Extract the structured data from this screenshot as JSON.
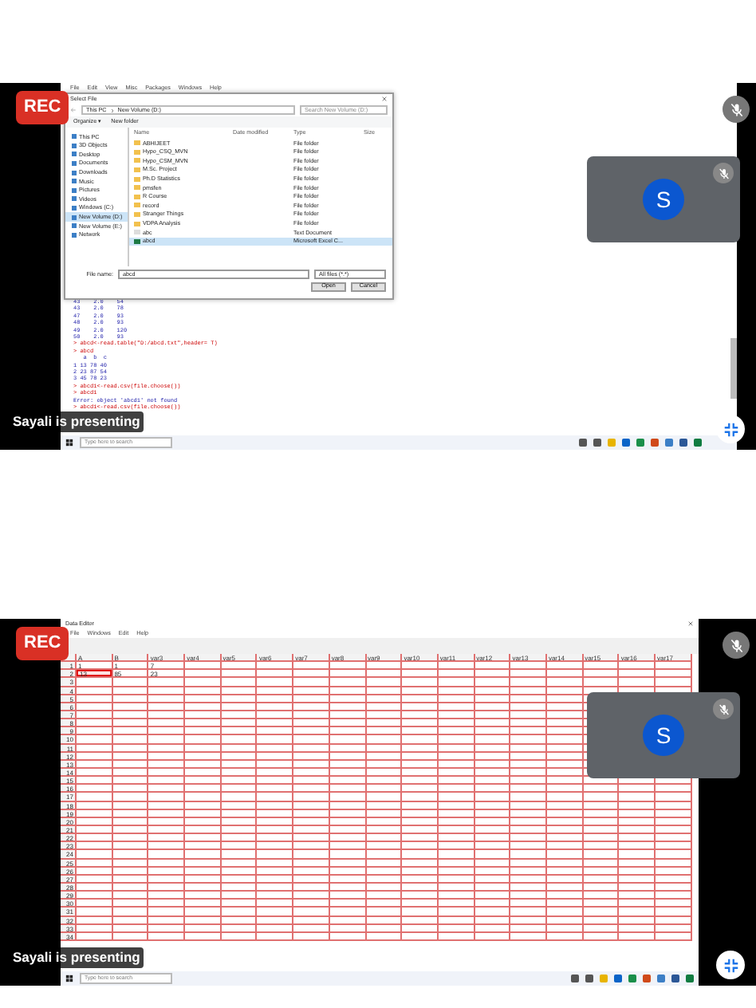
{
  "tiles": [
    {
      "rec": "REC",
      "presenter": "Sayali is presenting",
      "self_muted": true,
      "participant": {
        "initial": "S",
        "muted": true
      },
      "screen": {
        "kind": "r_console",
        "menu": [
          "File",
          "Edit",
          "View",
          "Misc",
          "Packages",
          "Windows",
          "Help"
        ],
        "dialog": {
          "title": "Select File",
          "path": [
            "This PC",
            "New Volume (D:)"
          ],
          "search_placeholder": "Search New Volume (D:)",
          "toolbar": [
            "Organize ▾",
            "New folder"
          ],
          "sidebar": [
            {
              "label": "This PC",
              "selected": false
            },
            {
              "label": "3D Objects",
              "selected": false
            },
            {
              "label": "Desktop",
              "selected": false
            },
            {
              "label": "Documents",
              "selected": false
            },
            {
              "label": "Downloads",
              "selected": false
            },
            {
              "label": "Music",
              "selected": false
            },
            {
              "label": "Pictures",
              "selected": false
            },
            {
              "label": "Videos",
              "selected": false
            },
            {
              "label": "Windows (C:)",
              "selected": false
            },
            {
              "label": "New Volume (D:)",
              "selected": true
            },
            {
              "label": "New Volume (E:)",
              "selected": false
            },
            {
              "label": "Network",
              "selected": false
            }
          ],
          "columns": [
            "Name",
            "Date modified",
            "Type",
            "Size"
          ],
          "files": [
            {
              "kind": "folder",
              "name": "ABHIJEET",
              "type": "File folder",
              "selected": false
            },
            {
              "kind": "folder",
              "name": "Hypo_CSQ_MVN",
              "type": "File folder",
              "selected": false
            },
            {
              "kind": "folder",
              "name": "Hypo_CSM_MVN",
              "type": "File folder",
              "selected": false
            },
            {
              "kind": "folder",
              "name": "M.Sc. Project",
              "type": "File folder",
              "selected": false
            },
            {
              "kind": "folder",
              "name": "Ph.D Statistics",
              "type": "File folder",
              "selected": false
            },
            {
              "kind": "folder",
              "name": "pmsfen",
              "type": "File folder",
              "selected": false
            },
            {
              "kind": "folder",
              "name": "R Course",
              "type": "File folder",
              "selected": false
            },
            {
              "kind": "folder",
              "name": "record",
              "type": "File folder",
              "selected": false
            },
            {
              "kind": "folder",
              "name": "Stranger Things",
              "type": "File folder",
              "selected": false
            },
            {
              "kind": "folder",
              "name": "VDPA Analysis",
              "type": "File folder",
              "selected": false
            },
            {
              "kind": "text",
              "name": "abc",
              "type": "Text Document",
              "selected": false
            },
            {
              "kind": "sheet",
              "name": "abcd",
              "type": "Microsoft Excel C...",
              "selected": true
            }
          ],
          "file_name_label": "File name:",
          "file_name": "abcd",
          "filter": "All files (*.*)",
          "buttons": [
            "Open",
            "Cancel"
          ]
        },
        "console": [
          {
            "kind": "output",
            "text": "43    2.0    54"
          },
          {
            "kind": "output",
            "text": "43    2.0    78"
          },
          {
            "kind": "output",
            "text": "47    2.0    93"
          },
          {
            "kind": "output",
            "text": "48    2.0    93"
          },
          {
            "kind": "output",
            "text": "49    2.0    120"
          },
          {
            "kind": "output",
            "text": "50    2.0    93"
          },
          {
            "kind": "input",
            "text": "> abcd<-read.table(\"D:/abcd.txt\",header= T)"
          },
          {
            "kind": "input",
            "text": "> abcd"
          },
          {
            "kind": "output",
            "text": "   a  b  c"
          },
          {
            "kind": "output",
            "text": "1 13 78 40"
          },
          {
            "kind": "output",
            "text": "2 23 87 54"
          },
          {
            "kind": "output",
            "text": "3 45 78 23"
          },
          {
            "kind": "input",
            "text": "> abcd1<-read.csv(file.choose())"
          },
          {
            "kind": "input",
            "text": "> abcd1"
          },
          {
            "kind": "output",
            "text": "Error: object 'abcd1' not found"
          },
          {
            "kind": "input",
            "text": "> abcd1<-read.csv(file.choose())"
          }
        ],
        "taskbar_search": "Type here to search"
      }
    },
    {
      "rec": "REC",
      "presenter": "Sayali is presenting",
      "self_muted": true,
      "participant": {
        "initial": "S",
        "muted": true
      },
      "screen": {
        "kind": "data_editor",
        "title": "Data Editor",
        "menu": [
          "File",
          "Windows",
          "Edit",
          "Help"
        ],
        "columns": [
          "A",
          "B",
          "var3",
          "var4",
          "var5",
          "var6",
          "var7",
          "var8",
          "var9",
          "var10",
          "var11",
          "var12",
          "var13",
          "var14",
          "var15",
          "var16",
          "var17"
        ],
        "rows": [
          {
            "label": "1",
            "cells": [
              {
                "value": "1",
                "selected": false
              },
              {
                "value": "1",
                "selected": false
              },
              {
                "value": "7",
                "selected": false
              }
            ]
          },
          {
            "label": "2",
            "cells": [
              {
                "value": "13",
                "selected": true
              },
              {
                "value": "85",
                "selected": false
              },
              {
                "value": "23",
                "selected": false
              }
            ]
          },
          {
            "label": "3",
            "cells": []
          },
          {
            "label": "4",
            "cells": []
          },
          {
            "label": "5",
            "cells": []
          },
          {
            "label": "6",
            "cells": []
          },
          {
            "label": "7",
            "cells": []
          },
          {
            "label": "8",
            "cells": []
          },
          {
            "label": "9",
            "cells": []
          },
          {
            "label": "10",
            "cells": []
          },
          {
            "label": "11",
            "cells": []
          },
          {
            "label": "12",
            "cells": []
          },
          {
            "label": "13",
            "cells": []
          },
          {
            "label": "14",
            "cells": []
          },
          {
            "label": "15",
            "cells": []
          },
          {
            "label": "16",
            "cells": []
          },
          {
            "label": "17",
            "cells": []
          },
          {
            "label": "18",
            "cells": []
          },
          {
            "label": "19",
            "cells": []
          },
          {
            "label": "20",
            "cells": []
          },
          {
            "label": "21",
            "cells": []
          },
          {
            "label": "22",
            "cells": []
          },
          {
            "label": "23",
            "cells": []
          },
          {
            "label": "24",
            "cells": []
          },
          {
            "label": "25",
            "cells": []
          },
          {
            "label": "26",
            "cells": []
          },
          {
            "label": "27",
            "cells": []
          },
          {
            "label": "28",
            "cells": []
          },
          {
            "label": "29",
            "cells": []
          },
          {
            "label": "30",
            "cells": []
          },
          {
            "label": "31",
            "cells": []
          },
          {
            "label": "32",
            "cells": []
          },
          {
            "label": "33",
            "cells": []
          },
          {
            "label": "34",
            "cells": []
          }
        ],
        "taskbar_search": "Type here to search"
      }
    }
  ]
}
